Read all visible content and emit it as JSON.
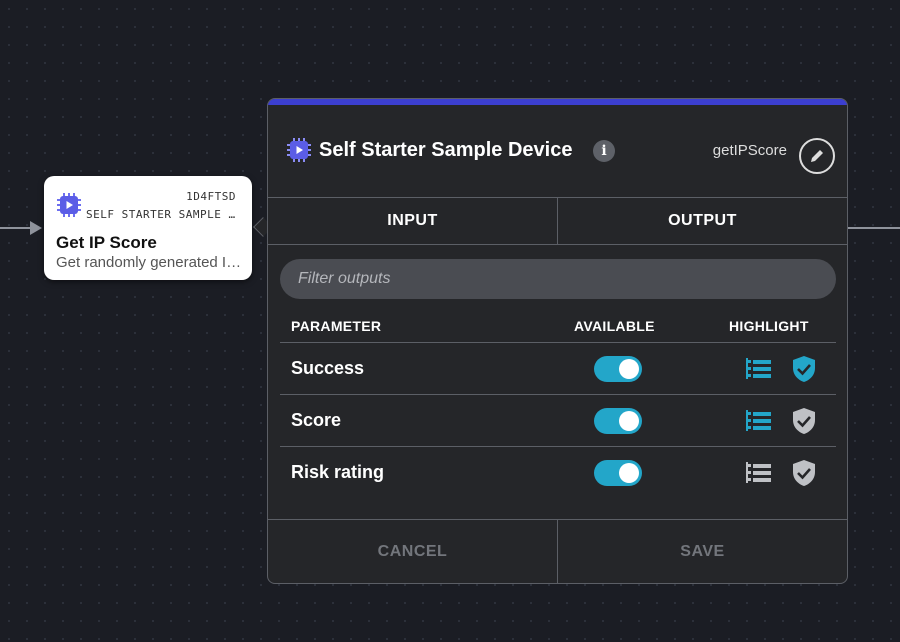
{
  "canvas": {
    "background": "#1b1d24"
  },
  "node": {
    "code": "1D4FTSD",
    "device": "SELF STARTER SAMPLE DEVICE",
    "title": "Get IP Score",
    "description": "Get randomly generated IP score"
  },
  "panel": {
    "accent_color": "#3c3fd0",
    "title": "Self Starter Sample Device",
    "info_label": "i",
    "method": "getIPScore",
    "tabs": [
      {
        "label": "INPUT",
        "active": false
      },
      {
        "label": "OUTPUT",
        "active": true
      }
    ],
    "filter_placeholder": "Filter outputs",
    "columns": {
      "parameter": "PARAMETER",
      "available": "AVAILABLE",
      "highlight": "HIGHLIGHT"
    },
    "rows": [
      {
        "name": "Success",
        "available": true,
        "list_highlighted": true,
        "shield_highlighted": true
      },
      {
        "name": "Score",
        "available": true,
        "list_highlighted": true,
        "shield_highlighted": false
      },
      {
        "name": "Risk rating",
        "available": true,
        "list_highlighted": false,
        "shield_highlighted": false
      }
    ],
    "cancel_label": "CANCEL",
    "save_label": "SAVE"
  },
  "colors": {
    "toggle_on": "#23a6c9",
    "highlight_on": "#23a6c9",
    "highlight_off": "#bfc1c5"
  }
}
